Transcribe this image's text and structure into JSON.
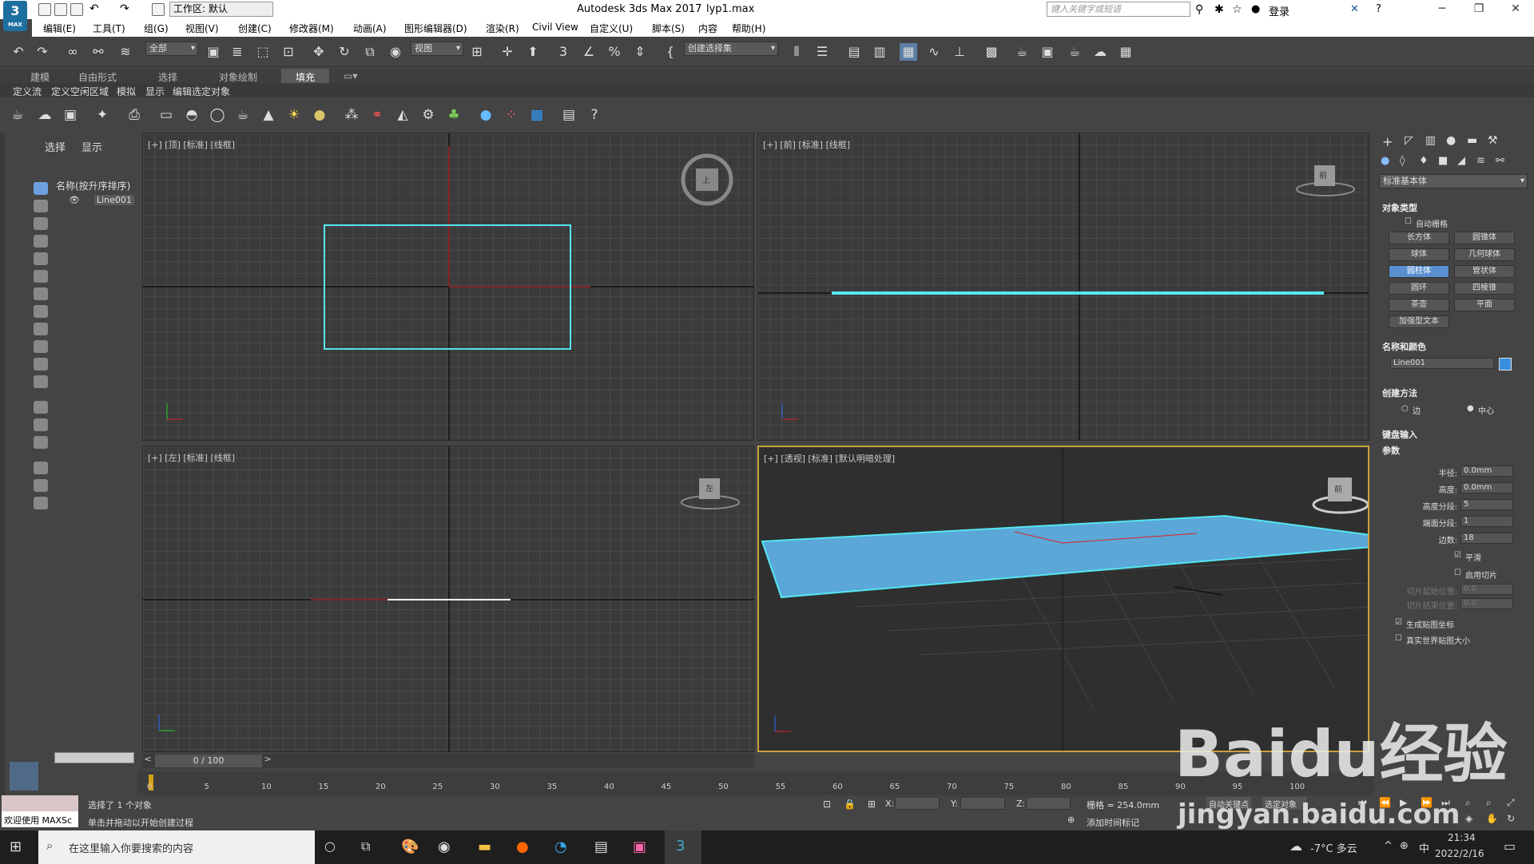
{
  "title_bar": {
    "workspace_label": "工作区: 默认",
    "app_title": "Autodesk 3ds Max 2017",
    "file_name": "lyp1.max",
    "search_placeholder": "键入关键字或短语",
    "login_label": "登录",
    "logo_text": "3",
    "logo_sub": "MAX"
  },
  "menu": [
    "编辑(E)",
    "工具(T)",
    "组(G)",
    "视图(V)",
    "创建(C)",
    "修改器(M)",
    "动画(A)",
    "图形编辑器(D)",
    "渲染(R)",
    "Civil View",
    "自定义(U)",
    "脚本(S)",
    "内容",
    "帮助(H)"
  ],
  "main_toolbar": {
    "selection_filter": "全部",
    "ref_coord": "视图",
    "named_selection": "创建选择集"
  },
  "ribbon_tabs": [
    "建模",
    "自由形式",
    "选择",
    "对象绘制",
    "填充"
  ],
  "ribbon_active_tab": "填充",
  "ribbon_subtabs": [
    "定义流",
    "定义空闲区域",
    "模拟",
    "显示",
    "编辑选定对象"
  ],
  "scene_explorer": {
    "tab_select": "选择",
    "tab_display": "显示",
    "column_header": "名称(按升序排序)",
    "items": [
      "Line001"
    ]
  },
  "viewports": {
    "top": "[+] [顶] [标准] [线框]",
    "front": "[+] [前] [标准] [线框]",
    "left": "[+] [左] [标准] [线框]",
    "perspective": "[+] [透视] [标准] [默认明暗处理]",
    "viewcube_top": "上",
    "viewcube_front": "前",
    "viewcube_left": "左",
    "viewcube_persp": "前"
  },
  "command_panel": {
    "category": "标准基本体",
    "object_type_header": "对象类型",
    "auto_grid": "自动栅格",
    "buttons": [
      "长方体",
      "圆锥体",
      "球体",
      "几何球体",
      "圆柱体",
      "管状体",
      "圆环",
      "四棱锥",
      "茶壶",
      "平面",
      "加强型文本"
    ],
    "active_button": "圆柱体",
    "name_color_header": "名称和颜色",
    "object_name": "Line001",
    "object_color": "#3a8ee0",
    "creation_method_header": "创建方法",
    "creation_options": [
      "边",
      "中心"
    ],
    "creation_selected": "中心",
    "keyboard_entry_header": "键盘输入",
    "params_header": "参数",
    "params": [
      {
        "label": "半径:",
        "value": "0.0mm"
      },
      {
        "label": "高度:",
        "value": "0.0mm"
      },
      {
        "label": "高度分段:",
        "value": "5"
      },
      {
        "label": "端面分段:",
        "value": "1"
      },
      {
        "label": "边数:",
        "value": "18"
      }
    ],
    "smooth_label": "平滑",
    "slice_label": "启用切片",
    "slice_from_label": "切片起始位置:",
    "slice_to_label": "切片结束位置:",
    "slice_from_value": "0.0",
    "slice_to_value": "0.0",
    "gen_map_label": "生成贴图坐标",
    "real_world_label": "真实世界贴图大小"
  },
  "time_slider": {
    "value": "0 / 100"
  },
  "trackbar_ticks": [
    "0",
    "5",
    "10",
    "15",
    "20",
    "25",
    "30",
    "35",
    "40",
    "45",
    "50",
    "55",
    "60",
    "65",
    "70",
    "75",
    "80",
    "85",
    "90",
    "95",
    "100"
  ],
  "status": {
    "maxscript": "欢迎使用 MAXSc",
    "selected": "选择了 1 个对象",
    "prompt": "单击并拖动以开始创建过程",
    "x_label": "X:",
    "y_label": "Y:",
    "z_label": "Z:",
    "grid": "栅格 = 254.0mm",
    "add_time_tag": "添加时间标记",
    "auto_key": "自动关键点",
    "selected_obj": "选定对象"
  },
  "taskbar": {
    "search_placeholder": "在这里输入你要搜索的内容",
    "weather": "-7°C 多云",
    "time": "21:34",
    "date": "2022/2/16",
    "ime": "中"
  },
  "watermark": {
    "brand": "Baidu经验",
    "url": "jingyan.baidu.com"
  },
  "colors": {
    "selection": "#55e6f0",
    "plane_fill": "#5aa7d8",
    "viewport_bg": "#3b3b3b"
  }
}
